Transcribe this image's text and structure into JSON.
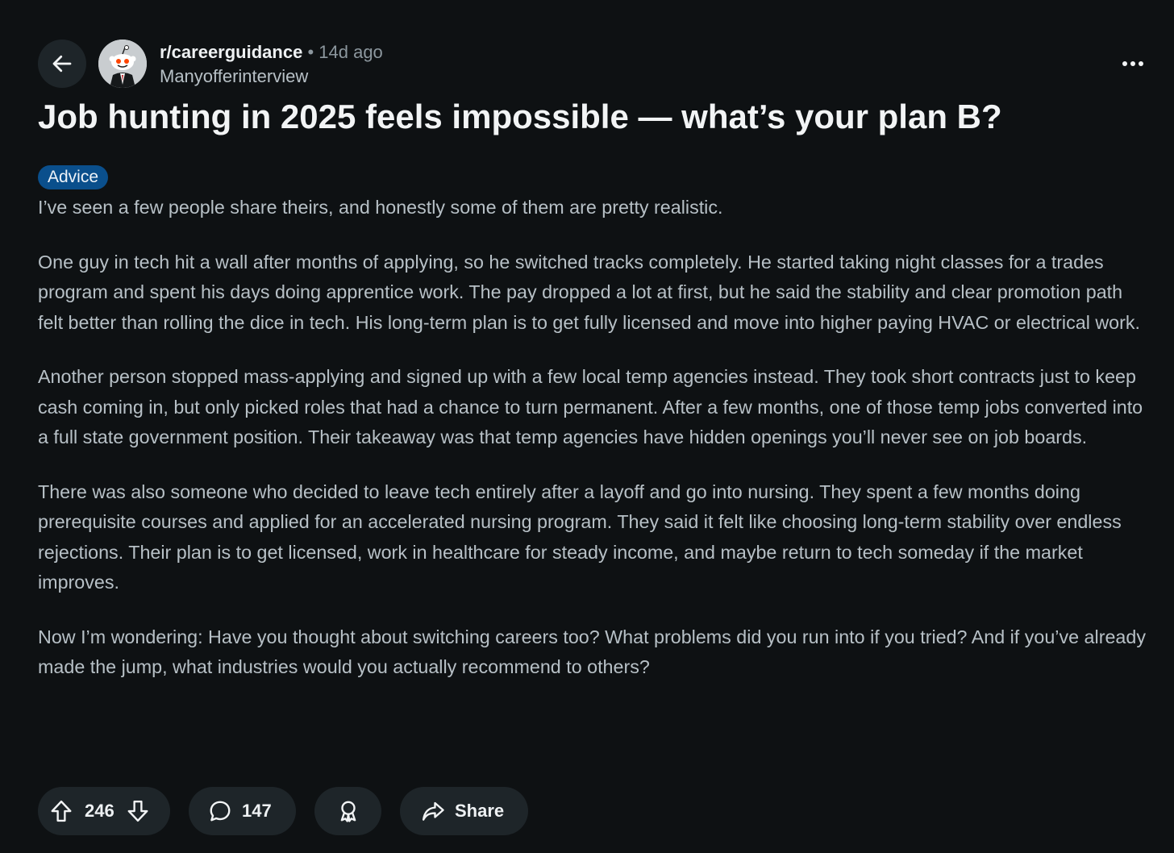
{
  "header": {
    "subreddit": "r/careerguidance",
    "separator": "•",
    "time_ago": "14d ago",
    "author": "Manyofferinterview"
  },
  "post": {
    "title": "Job hunting in 2025 feels impossible — what’s your plan B?",
    "flair": "Advice",
    "flair_color": "#0a4f8c",
    "paragraphs": [
      "I’ve seen a few people share theirs, and honestly some of them are pretty realistic.",
      "One guy in tech hit a wall after months of applying, so he switched tracks completely. He started taking night classes for a trades program and spent his days doing apprentice work. The pay dropped a lot at first, but he said the stability and clear promotion path felt better than rolling the dice in tech. His long-term plan is to get fully licensed and move into higher paying HVAC or electrical work.",
      "Another person stopped mass-applying and signed up with a few local temp agencies instead. They took short contracts just to keep cash coming in, but only picked roles that had a chance to turn permanent. After a few months, one of those temp jobs converted into a full state government position. Their takeaway was that temp agencies have hidden openings you’ll never see on job boards.",
      "There was also someone who decided to leave tech entirely after a layoff and go into nursing. They spent a few months doing prerequisite courses and applied for an accelerated nursing program. They said it felt like choosing long-term stability over endless rejections. Their plan is to get licensed, work in healthcare for steady income, and maybe return to tech someday if the market improves.",
      "Now I’m wondering: Have you thought about switching careers too? What problems did you run into if you tried? And if you’ve already made the jump, what industries would you actually recommend to others?"
    ]
  },
  "actions": {
    "score": "246",
    "comments": "147",
    "share_label": "Share"
  },
  "icons": {
    "back": "arrow-left-icon",
    "more": "ellipsis-icon",
    "upvote": "arrow-up-icon",
    "downvote": "arrow-down-icon",
    "comment": "speech-bubble-icon",
    "award": "award-icon",
    "share": "share-arrow-icon"
  },
  "colors": {
    "background": "#0e1113",
    "pill_background": "#1e2529",
    "title": "#f2f4f5",
    "body": "#b7c0c6"
  }
}
